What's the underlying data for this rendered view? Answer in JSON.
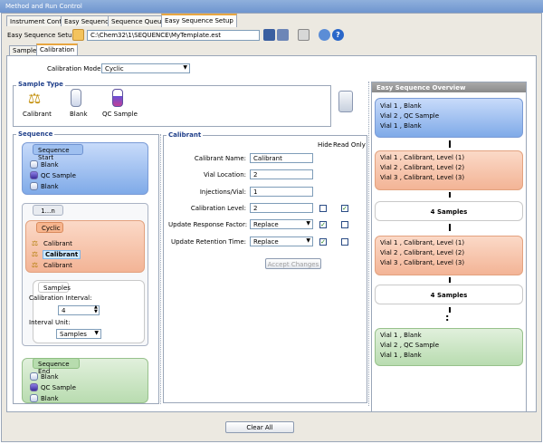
{
  "window": {
    "title": "Method and Run Control"
  },
  "tabs": [
    "Instrument Control",
    "Easy Sequence",
    "Sequence Queue",
    "Easy Sequence Setup"
  ],
  "toolbar": {
    "label": "Easy Sequence Setup",
    "path": "C:\\Chem32\\1\\SEQUENCE\\MyTemplate.est"
  },
  "subtabs": [
    "Samples",
    "Calibration"
  ],
  "calibration_mode": {
    "label": "Calibration Mode:",
    "value": "Cyclic"
  },
  "sample_type": {
    "title": "Sample Type",
    "items": [
      {
        "label": "Calibrant",
        "icon": "scale-icon"
      },
      {
        "label": "Blank",
        "icon": "vial-blank-icon"
      },
      {
        "label": "QC Sample",
        "icon": "vial-qc-icon"
      }
    ]
  },
  "sequence": {
    "title": "Sequence",
    "start": {
      "header": "Sequence Start",
      "rows": [
        "Blank",
        "QC Sample",
        "Blank"
      ]
    },
    "loop_label": "1...n",
    "cyclic": {
      "header": "Cyclic",
      "rows": [
        "Calibrant",
        "Calibrant",
        "Calibrant"
      ]
    },
    "samples": {
      "header": "Samples",
      "interval_label": "Calibration Interval:",
      "interval_value": "4",
      "unit_label": "Interval Unit:",
      "unit_value": "Samples"
    },
    "end": {
      "header": "Sequence End",
      "rows": [
        "Blank",
        "QC Sample",
        "Blank"
      ]
    }
  },
  "calibrant": {
    "title": "Calibrant",
    "hide_label": "Hide",
    "readonly_label": "Read Only",
    "fields": {
      "name_label": "Calibrant Name:",
      "name_value": "Calibrant",
      "vial_label": "Vial Location:",
      "vial_value": "2",
      "inj_label": "Injections/Vial:",
      "inj_value": "1",
      "level_label": "Calibration Level:",
      "level_value": "2",
      "urf_label": "Update Response Factor:",
      "urf_value": "Replace",
      "urt_label": "Update Retention Time:",
      "urt_value": "Replace"
    },
    "accept_button": "Accept Changes"
  },
  "overview": {
    "title": "Easy Sequence Overview",
    "block1": [
      "Vial 1 , Blank",
      "Vial 2 , QC Sample",
      "Vial 1 , Blank"
    ],
    "block2": [
      "Vial 1 , Calibrant, Level (1)",
      "Vial 2 , Calibrant, Level (2)",
      "Vial 3 , Calibrant, Level (3)"
    ],
    "samples_a": "4 Samples",
    "block3": [
      "Vial 1 , Calibrant, Level (1)",
      "Vial 2 , Calibrant, Level (2)",
      "Vial 3 , Calibrant, Level (3)"
    ],
    "samples_b": "4 Samples",
    "dots": ":",
    "block4": [
      "Vial 1 , Blank",
      "Vial 2 , QC Sample",
      "Vial 1 , Blank"
    ]
  },
  "footer": {
    "clear_all": "Clear All"
  }
}
